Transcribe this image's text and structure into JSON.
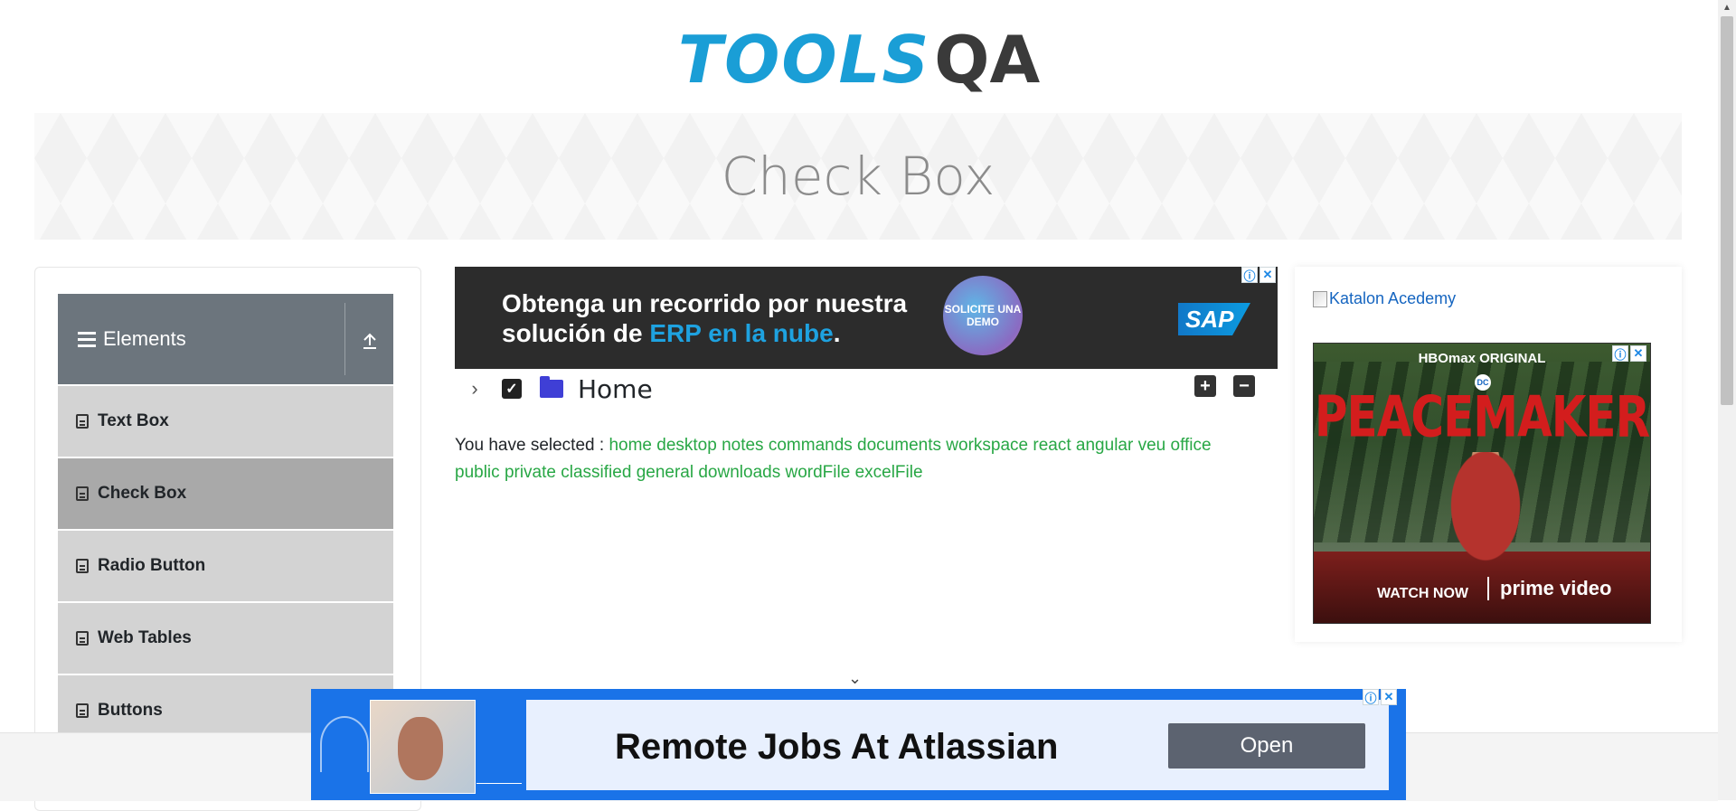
{
  "logo": {
    "part1": "TOOLS",
    "part2": "QA"
  },
  "page": {
    "title": "Check Box"
  },
  "sidebar": {
    "group_title": "Elements",
    "items": [
      {
        "label": "Text Box"
      },
      {
        "label": "Check Box"
      },
      {
        "label": "Radio Button"
      },
      {
        "label": "Web Tables"
      },
      {
        "label": "Buttons"
      }
    ]
  },
  "sap_ad": {
    "line1": "Obtenga un recorrido por nuestra",
    "line2_pre": "solución de ",
    "line2_highlight": "ERP en la nube",
    "line2_post": ".",
    "cta": "SOLICITE UNA DEMO",
    "brand": "SAP"
  },
  "tree": {
    "root_label": "Home",
    "expand_all": "+",
    "collapse_all": "−"
  },
  "result": {
    "label": "You have selected :",
    "selected": [
      "home",
      "desktop",
      "notes",
      "commands",
      "documents",
      "workspace",
      "react",
      "angular",
      "veu",
      "office",
      "public",
      "private",
      "classified",
      "general",
      "downloads",
      "wordFile",
      "excelFile"
    ]
  },
  "right_ad": {
    "katalon_alt": "Katalon Acedemy",
    "hbo": "HBOmax ORIGINAL",
    "dc": "DC",
    "title": "PEACEMAKER",
    "watch": "WATCH NOW",
    "provider": "prime video"
  },
  "bottom_ad": {
    "headline": "Remote Jobs At Atlassian",
    "button": "Open"
  },
  "colors": {
    "accent_blue": "#1a9ed6",
    "selected_green": "#28a745",
    "menu_header": "#6c757d",
    "menu_item": "#d3d3d3",
    "menu_active": "#a9a9a9"
  }
}
